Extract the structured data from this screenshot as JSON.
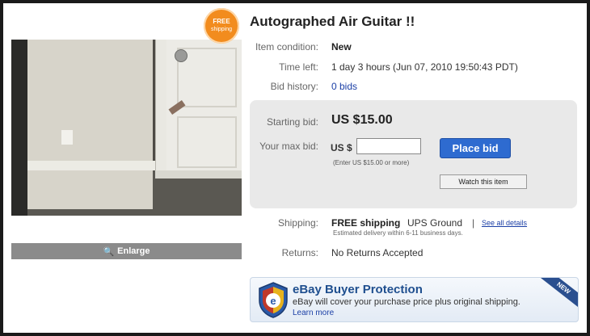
{
  "badge": {
    "line1": "FREE",
    "line2": "shipping"
  },
  "listing": {
    "title": "Autographed Air Guitar !!",
    "condition_label": "Item condition:",
    "condition_value": "New",
    "time_left_label": "Time left:",
    "time_left_value": "1 day 3 hours (Jun 07, 2010 19:50:43 PDT)",
    "bid_history_label": "Bid history:",
    "bid_history_value": "0 bids"
  },
  "bid": {
    "starting_label": "Starting bid:",
    "starting_value": "US $15.00",
    "max_label": "Your max bid:",
    "currency_prefix": "US $",
    "input_value": "",
    "place_bid_label": "Place bid",
    "hint": "(Enter US $15.00 or more)",
    "watch_label": "Watch this item"
  },
  "shipping": {
    "label": "Shipping:",
    "free": "FREE shipping",
    "service": "UPS Ground",
    "separator": "|",
    "details_link": "See all details",
    "estimate": "Estimated delivery within 6-11 business days."
  },
  "returns": {
    "label": "Returns:",
    "value": "No Returns Accepted"
  },
  "photo": {
    "enlarge_label": "Enlarge"
  },
  "protection": {
    "title": "eBay Buyer Protection",
    "text": "eBay will cover your purchase price plus original shipping.",
    "link": "Learn more",
    "ribbon": "NEW"
  }
}
